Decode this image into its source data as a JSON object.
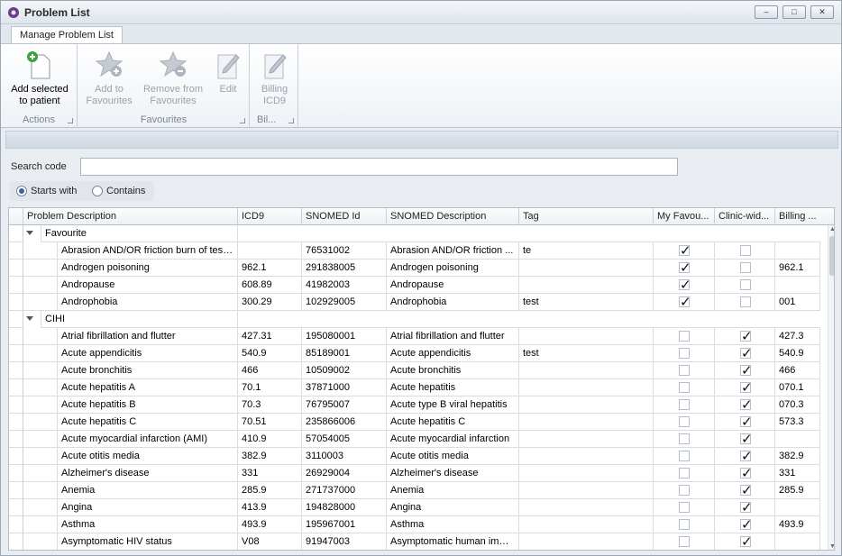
{
  "window": {
    "title": "Problem List",
    "min": "–",
    "max": "□",
    "close": "✕"
  },
  "tabs": [
    "Manage Problem List"
  ],
  "ribbon": {
    "add_selected": "Add selected to patient",
    "add_fav": "Add to Favourites",
    "remove_fav": "Remove from Favourites",
    "edit": "Edit",
    "billing": "Billing ICD9",
    "groups": {
      "actions": "Actions",
      "favourites": "Favourites",
      "bil": "Bil..."
    }
  },
  "search": {
    "label": "Search code",
    "value": ""
  },
  "match_mode": {
    "starts_with": "Starts with",
    "contains": "Contains",
    "selected": "starts_with"
  },
  "grid": {
    "columns": [
      "Problem Description",
      "ICD9",
      "SNOMED Id",
      "SNOMED Description",
      "Tag",
      "My Favou...",
      "Clinic-wid...",
      "Billing ..."
    ],
    "groups": [
      {
        "name": "Favourite",
        "rows": [
          {
            "desc": "Abrasion AND/OR friction burn of test...",
            "icd9": "",
            "snomed_id": "76531002",
            "snomed_desc": "Abrasion AND/OR friction ...",
            "tag": "te",
            "my_fav": true,
            "clinic": false,
            "billing": ""
          },
          {
            "desc": "Androgen poisoning",
            "icd9": "962.1",
            "snomed_id": "291838005",
            "snomed_desc": "Androgen poisoning",
            "tag": "",
            "my_fav": true,
            "clinic": false,
            "billing": "962.1"
          },
          {
            "desc": "Andropause",
            "icd9": "608.89",
            "snomed_id": "41982003",
            "snomed_desc": "Andropause",
            "tag": "",
            "my_fav": true,
            "clinic": false,
            "billing": ""
          },
          {
            "desc": "Androphobia",
            "icd9": "300.29",
            "snomed_id": "102929005",
            "snomed_desc": "Androphobia",
            "tag": "test",
            "my_fav": true,
            "clinic": false,
            "billing": "001"
          }
        ]
      },
      {
        "name": "CIHI",
        "rows": [
          {
            "desc": " Atrial fibrillation and flutter",
            "icd9": "427.31",
            "snomed_id": "195080001",
            "snomed_desc": "Atrial fibrillation and flutter",
            "tag": "",
            "my_fav": false,
            "clinic": true,
            "billing": "427.3"
          },
          {
            "desc": "Acute appendicitis",
            "icd9": "540.9",
            "snomed_id": "85189001",
            "snomed_desc": "Acute appendicitis",
            "tag": "test",
            "my_fav": false,
            "clinic": true,
            "billing": "540.9"
          },
          {
            "desc": "Acute bronchitis",
            "icd9": "466",
            "snomed_id": "10509002",
            "snomed_desc": "Acute bronchitis",
            "tag": "",
            "my_fav": false,
            "clinic": true,
            "billing": "466"
          },
          {
            "desc": "Acute hepatitis A",
            "icd9": "70.1",
            "snomed_id": "37871000",
            "snomed_desc": "Acute hepatitis",
            "tag": "",
            "my_fav": false,
            "clinic": true,
            "billing": "070.1"
          },
          {
            "desc": "Acute hepatitis B",
            "icd9": "70.3",
            "snomed_id": "76795007",
            "snomed_desc": "Acute type B viral hepatitis",
            "tag": "",
            "my_fav": false,
            "clinic": true,
            "billing": "070.3"
          },
          {
            "desc": "Acute hepatitis C",
            "icd9": "70.51",
            "snomed_id": "235866006",
            "snomed_desc": "Acute hepatitis C",
            "tag": "",
            "my_fav": false,
            "clinic": true,
            "billing": "573.3"
          },
          {
            "desc": "Acute myocardial infarction (AMI)",
            "icd9": "410.9",
            "snomed_id": "57054005",
            "snomed_desc": "Acute myocardial infarction",
            "tag": "",
            "my_fav": false,
            "clinic": true,
            "billing": ""
          },
          {
            "desc": "Acute otitis media",
            "icd9": "382.9",
            "snomed_id": "3110003",
            "snomed_desc": "Acute otitis media",
            "tag": "",
            "my_fav": false,
            "clinic": true,
            "billing": "382.9"
          },
          {
            "desc": "Alzheimer's disease",
            "icd9": "331",
            "snomed_id": "26929004",
            "snomed_desc": "Alzheimer's disease",
            "tag": "",
            "my_fav": false,
            "clinic": true,
            "billing": "331"
          },
          {
            "desc": "Anemia",
            "icd9": "285.9",
            "snomed_id": "271737000",
            "snomed_desc": "Anemia",
            "tag": "",
            "my_fav": false,
            "clinic": true,
            "billing": "285.9"
          },
          {
            "desc": "Angina",
            "icd9": "413.9",
            "snomed_id": "194828000",
            "snomed_desc": "Angina",
            "tag": "",
            "my_fav": false,
            "clinic": true,
            "billing": ""
          },
          {
            "desc": "Asthma",
            "icd9": "493.9",
            "snomed_id": "195967001",
            "snomed_desc": "Asthma",
            "tag": "",
            "my_fav": false,
            "clinic": true,
            "billing": "493.9"
          },
          {
            "desc": "Asymptomatic HIV status",
            "icd9": "V08",
            "snomed_id": "91947003",
            "snomed_desc": "Asymptomatic human imm...",
            "tag": "",
            "my_fav": false,
            "clinic": true,
            "billing": ""
          }
        ]
      }
    ]
  }
}
